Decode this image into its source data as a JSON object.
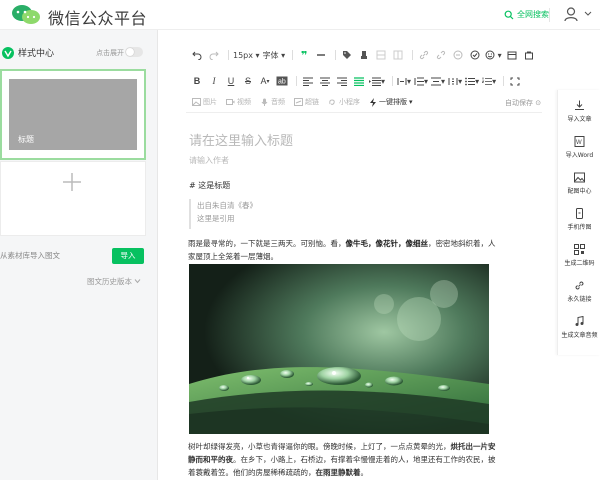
{
  "app": {
    "title": "微信公众平台",
    "global_search": "全网搜索"
  },
  "left": {
    "style_center": "样式中心",
    "expand_label": "点击展开",
    "cover_label": "标题",
    "import_from_material": "从素材库导入图文",
    "import_button": "导入",
    "history_versions": "图文历史版本"
  },
  "toolbar": {
    "font_size": "15px",
    "font_family": "字体",
    "media_image": "图片",
    "media_video": "视频",
    "media_audio": "音频",
    "media_hyperlink": "超链",
    "media_miniprogram": "小程序",
    "one_key_layout": "一键排版",
    "autosave": "自动保存"
  },
  "editor": {
    "title_placeholder": "请在这里输入标题",
    "author_placeholder": "请输入作者",
    "heading": "# 这是标题",
    "quote_line1": "出自朱自清《春》",
    "quote_line2": "这里是引用",
    "para1_a": "雨是最寻常的，一下就是三两天。可别恼。看，",
    "para1_b": "像牛毛，像花针，像细丝",
    "para1_c": "，密密地斜织着，人家屋顶上全笼着一层薄烟。",
    "para2_a": "树叶却绿得发亮，小草也青得逼你的眼。傍晚时候，上灯了，一点点黄晕的光，",
    "para2_b": "烘托出一片安静而和平的夜",
    "para2_c": "。在乡下，小路上，石桥边，有撑着伞慢慢走着的人，地里还有工作的农民，披着蓑戴着笠。他们的房屋稀稀疏疏的，",
    "para2_d": "在雨里静默着",
    "para2_e": "。"
  },
  "right_tools": [
    {
      "label": "导入文章",
      "icon": "import-article-icon"
    },
    {
      "label": "导入Word",
      "icon": "word-icon"
    },
    {
      "label": "配图中心",
      "icon": "image-center-icon"
    },
    {
      "label": "手机传图",
      "icon": "phone-upload-icon"
    },
    {
      "label": "生成二维码",
      "icon": "qrcode-icon"
    },
    {
      "label": "永久链接",
      "icon": "link-icon"
    },
    {
      "label": "生成文章音频",
      "icon": "audio-icon"
    }
  ],
  "colors": {
    "brand_green": "#07c160",
    "placeholder_gray": "#b8b8b8",
    "cover_gray": "#a6a6a6"
  }
}
